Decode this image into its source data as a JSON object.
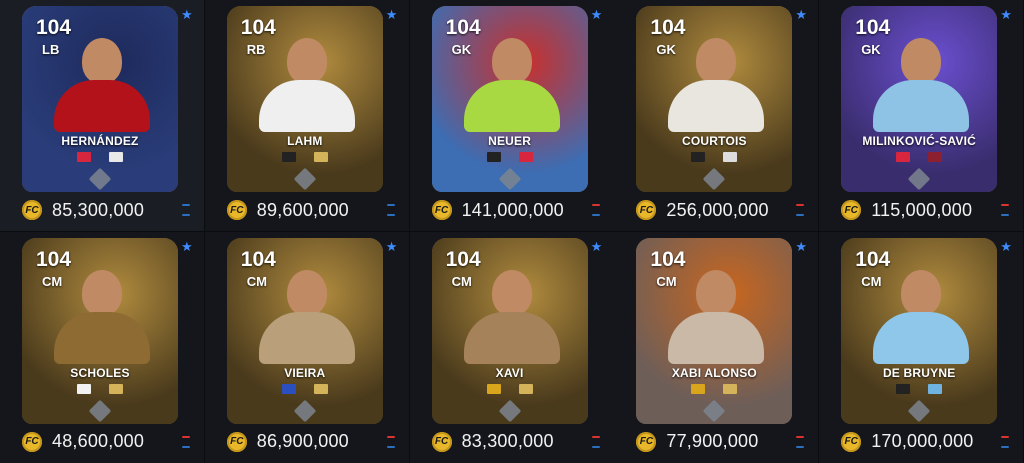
{
  "cards": [
    {
      "rating": "104",
      "position": "LB",
      "name": "HERNÁNDEZ",
      "price": "85,300,000",
      "bg": "#2a3d7a",
      "accent": "#1e2a5c",
      "kit": "#b4121b",
      "flag1": "#d7263d",
      "flag2": "#e8e8e8",
      "trend_top": "#2b6fbf",
      "trend_bottom": "#2b6fbf"
    },
    {
      "rating": "104",
      "position": "RB",
      "name": "LAHM",
      "price": "89,600,000",
      "bg": "#4a3a1c",
      "accent": "#b08b3e",
      "kit": "#efefef",
      "flag1": "#222222",
      "flag2": "#d4b35a",
      "trend_top": "#2b6fbf",
      "trend_bottom": "#2b6fbf"
    },
    {
      "rating": "104",
      "position": "GK",
      "name": "NEUER",
      "price": "141,000,000",
      "bg": "#3d6db3",
      "accent": "#c9302c",
      "kit": "#a8d943",
      "flag1": "#222222",
      "flag2": "#d7263d",
      "trend_top": "#d9342f",
      "trend_bottom": "#2b6fbf"
    },
    {
      "rating": "104",
      "position": "GK",
      "name": "COURTOIS",
      "price": "256,000,000",
      "bg": "#4a3a1c",
      "accent": "#b08b3e",
      "kit": "#e9e6df",
      "flag1": "#222222",
      "flag2": "#dddddd",
      "trend_top": "#d9342f",
      "trend_bottom": "#2b6fbf"
    },
    {
      "rating": "104",
      "position": "GK",
      "name": "MILINKOVIĆ-SAVIĆ",
      "price": "115,000,000",
      "bg": "#3a2d6e",
      "accent": "#6a4fcf",
      "kit": "#8fc3e6",
      "flag1": "#d7263d",
      "flag2": "#8c2030",
      "trend_top": "#d9342f",
      "trend_bottom": "#2b6fbf"
    },
    {
      "rating": "104",
      "position": "CM",
      "name": "SCHOLES",
      "price": "48,600,000",
      "bg": "#4a3a1c",
      "accent": "#b08b3e",
      "kit": "#8d6b32",
      "flag1": "#f2f2f2",
      "flag2": "#d4b35a",
      "trend_top": "#d9342f",
      "trend_bottom": "#2b6fbf"
    },
    {
      "rating": "104",
      "position": "CM",
      "name": "VIEIRA",
      "price": "86,900,000",
      "bg": "#4a3a1c",
      "accent": "#b08b3e",
      "kit": "#b9a07a",
      "flag1": "#2b4fbf",
      "flag2": "#d4b35a",
      "trend_top": "#d9342f",
      "trend_bottom": "#2b6fbf"
    },
    {
      "rating": "104",
      "position": "CM",
      "name": "XAVI",
      "price": "83,300,000",
      "bg": "#4a3a1c",
      "accent": "#b08b3e",
      "kit": "#a6825a",
      "flag1": "#d9a51c",
      "flag2": "#d4b35a",
      "trend_top": "#d9342f",
      "trend_bottom": "#2b6fbf"
    },
    {
      "rating": "104",
      "position": "CM",
      "name": "XABI ALONSO",
      "price": "77,900,000",
      "bg": "#6e5e58",
      "accent": "#c8661f",
      "kit": "#c9b9a6",
      "flag1": "#d9a51c",
      "flag2": "#d4b35a",
      "trend_top": "#d9342f",
      "trend_bottom": "#2b6fbf"
    },
    {
      "rating": "104",
      "position": "CM",
      "name": "DE BRUYNE",
      "price": "170,000,000",
      "bg": "#4a3a1c",
      "accent": "#b08b3e",
      "kit": "#8fc7ea",
      "flag1": "#222222",
      "flag2": "#6fb3e0",
      "trend_top": "#d9342f",
      "trend_bottom": "#2b6fbf"
    }
  ],
  "coin_symbol": "fc-coin-icon",
  "star_icon": "star-icon"
}
